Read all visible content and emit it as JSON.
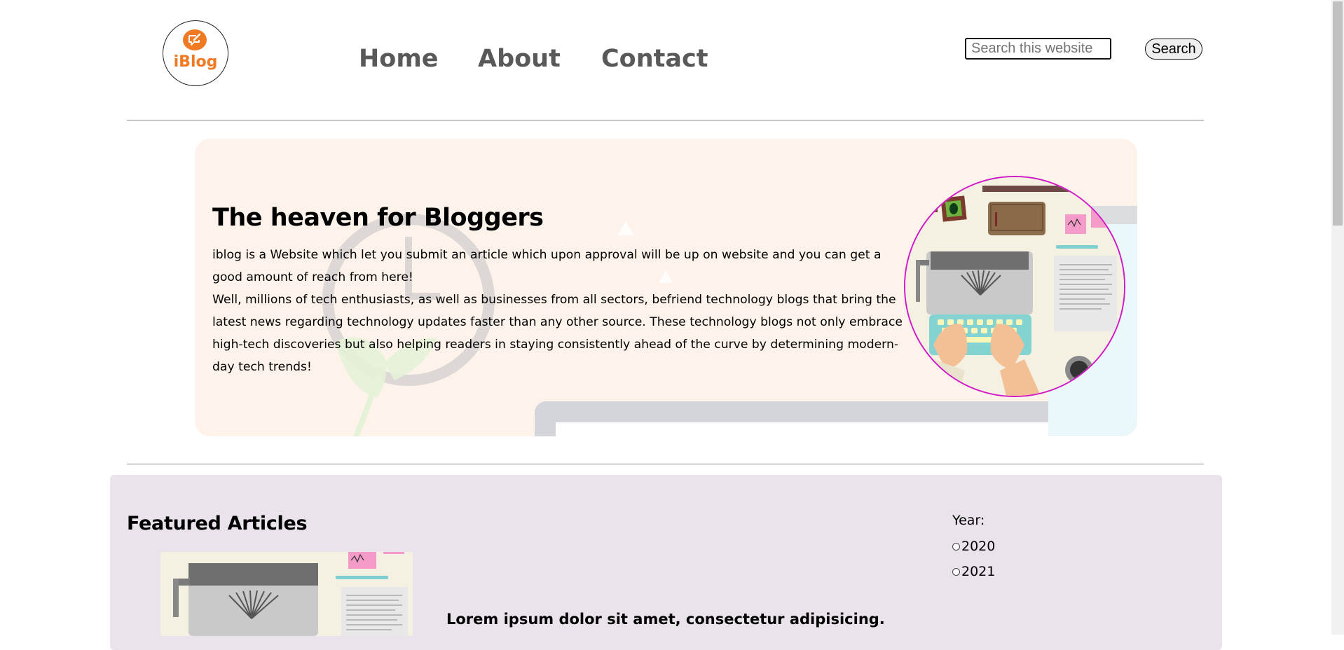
{
  "brand": {
    "logo_text": "iBlog",
    "accent": "#f07a24"
  },
  "nav": {
    "items": [
      "Home",
      "About",
      "Contact"
    ]
  },
  "search": {
    "placeholder": "Search this website",
    "button_label": "Search"
  },
  "hero": {
    "title": "The heaven for Bloggers",
    "paragraph": "iblog is a Website which let you submit an article which upon approval will be up on website and you can get a good amount of reach from here!",
    "paragraph2": "Well, millions of tech enthusiasts, as well as businesses from all sectors, befriend technology blogs that bring the latest news regarding technology updates faster than any other source. These technology blogs not only embrace high-tech discoveries but also helping readers in staying consistently ahead of the curve by determining modern-day tech trends!",
    "background": "#fdf3ea",
    "image_border": "#d11ac7"
  },
  "featured": {
    "title": "Featured Articles",
    "background": "#ebe3ec",
    "article_title": "Lorem ipsum dolor sit amet, consectetur adipisicing.",
    "filter": {
      "label": "Year:",
      "options": [
        "2020",
        "2021"
      ]
    }
  },
  "icons": [
    "edit-chat-icon",
    "typewriter-illustration",
    "radio-icon"
  ]
}
